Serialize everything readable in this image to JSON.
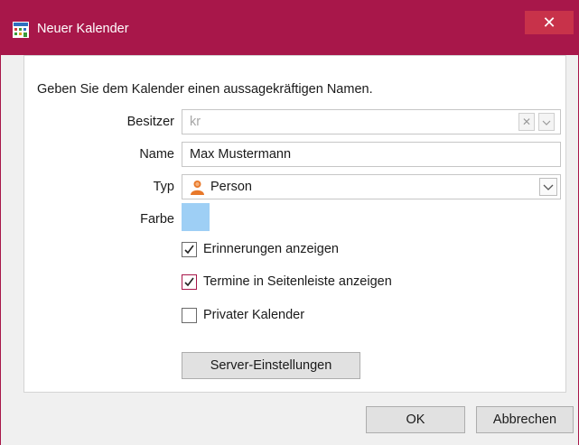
{
  "window": {
    "title": "Neuer Kalender",
    "close_symbol": "✕",
    "title_icon": "calendar-app-icon",
    "accent_color": "#a8174a"
  },
  "form": {
    "intro": "Geben Sie dem Kalender einen aussagekräftigen Namen.",
    "owner": {
      "label": "Besitzer",
      "value": "kr",
      "clear_symbol": "✕",
      "dropdown_icon": "chevron-down-icon"
    },
    "name": {
      "label": "Name",
      "value": "Max Mustermann"
    },
    "type": {
      "label": "Typ",
      "value": "Person",
      "icon": "person-icon",
      "dropdown_icon": "chevron-down-icon"
    },
    "color": {
      "label": "Farbe",
      "value": "#9ecff5"
    },
    "options": [
      {
        "label": "Erinnerungen anzeigen",
        "checked": true
      },
      {
        "label": "Termine in Seitenleiste anzeigen",
        "checked": true
      },
      {
        "label": "Privater Kalender",
        "checked": false
      }
    ],
    "server_button": "Server-Einstellungen"
  },
  "footer": {
    "ok": "OK",
    "cancel": "Abbrechen"
  }
}
